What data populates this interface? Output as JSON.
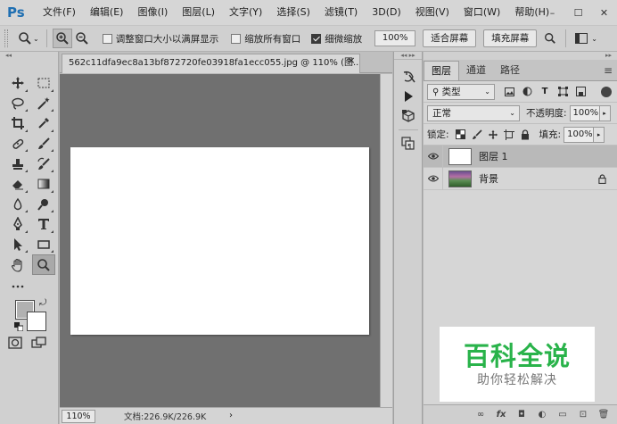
{
  "app": {
    "logo": "Ps",
    "menu": [
      "文件(F)",
      "编辑(E)",
      "图像(I)",
      "图层(L)",
      "文字(Y)",
      "选择(S)",
      "滤镜(T)",
      "3D(D)",
      "视图(V)",
      "窗口(W)",
      "帮助(H)"
    ],
    "window_controls": {
      "minimize": "–",
      "maximize": "☐",
      "close": "✕"
    }
  },
  "options": {
    "resize_windows_label": "调整窗口大小以满屏显示",
    "zoom_all_label": "缩放所有窗口",
    "scrubby_zoom_label": "细微缩放",
    "zoom_value": "100%",
    "fit_screen_label": "适合屏幕",
    "fill_screen_label": "填充屏幕",
    "resize_windows_checked": false,
    "zoom_all_checked": false,
    "scrubby_zoom_checked": true
  },
  "document": {
    "tab_title": "562c11dfa9ec8a13bf872720fe03918fa1ecc055.jpg @ 110% (图...",
    "tab_close": "×",
    "canvas_color": "#ffffff"
  },
  "status": {
    "zoom": "110%",
    "doc_info": "文档:226.9K/226.9K",
    "arrow": "›"
  },
  "toolbox": {
    "fg_color": "#b1b1b1",
    "bg_color": "#ffffff"
  },
  "layers_panel": {
    "tabs": [
      "图层",
      "通道",
      "路径"
    ],
    "filter_kind": "类型",
    "blend_mode": "正常",
    "opacity_label": "不透明度:",
    "opacity_value": "100%",
    "lock_label": "锁定:",
    "fill_label": "填充:",
    "fill_value": "100%",
    "layers": [
      {
        "name": "图层 1",
        "selected": true,
        "locked": false
      },
      {
        "name": "背景",
        "selected": false,
        "locked": true
      }
    ],
    "footer_icons": [
      "link-icon",
      "fx-icon",
      "mask-icon",
      "adjustment-icon",
      "group-icon",
      "new-layer-icon",
      "delete-icon"
    ]
  },
  "watermark": {
    "title": "百科全说",
    "subtitle": "助你轻松解决"
  }
}
